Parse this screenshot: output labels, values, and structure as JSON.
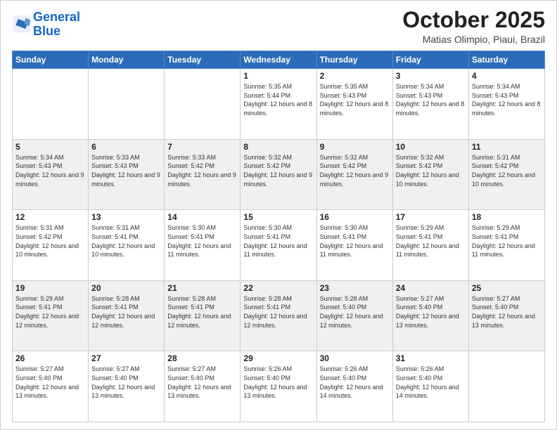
{
  "header": {
    "logo_line1": "General",
    "logo_line2": "Blue",
    "month": "October 2025",
    "location": "Matias Olimpio, Piaui, Brazil"
  },
  "weekdays": [
    "Sunday",
    "Monday",
    "Tuesday",
    "Wednesday",
    "Thursday",
    "Friday",
    "Saturday"
  ],
  "weeks": [
    [
      {
        "day": "",
        "sunrise": "",
        "sunset": "",
        "daylight": ""
      },
      {
        "day": "",
        "sunrise": "",
        "sunset": "",
        "daylight": ""
      },
      {
        "day": "",
        "sunrise": "",
        "sunset": "",
        "daylight": ""
      },
      {
        "day": "1",
        "sunrise": "Sunrise: 5:35 AM",
        "sunset": "Sunset: 5:44 PM",
        "daylight": "Daylight: 12 hours and 8 minutes."
      },
      {
        "day": "2",
        "sunrise": "Sunrise: 5:35 AM",
        "sunset": "Sunset: 5:43 PM",
        "daylight": "Daylight: 12 hours and 8 minutes."
      },
      {
        "day": "3",
        "sunrise": "Sunrise: 5:34 AM",
        "sunset": "Sunset: 5:43 PM",
        "daylight": "Daylight: 12 hours and 8 minutes."
      },
      {
        "day": "4",
        "sunrise": "Sunrise: 5:34 AM",
        "sunset": "Sunset: 5:43 PM",
        "daylight": "Daylight: 12 hours and 8 minutes."
      }
    ],
    [
      {
        "day": "5",
        "sunrise": "Sunrise: 5:34 AM",
        "sunset": "Sunset: 5:43 PM",
        "daylight": "Daylight: 12 hours and 9 minutes."
      },
      {
        "day": "6",
        "sunrise": "Sunrise: 5:33 AM",
        "sunset": "Sunset: 5:43 PM",
        "daylight": "Daylight: 12 hours and 9 minutes."
      },
      {
        "day": "7",
        "sunrise": "Sunrise: 5:33 AM",
        "sunset": "Sunset: 5:42 PM",
        "daylight": "Daylight: 12 hours and 9 minutes."
      },
      {
        "day": "8",
        "sunrise": "Sunrise: 5:32 AM",
        "sunset": "Sunset: 5:42 PM",
        "daylight": "Daylight: 12 hours and 9 minutes."
      },
      {
        "day": "9",
        "sunrise": "Sunrise: 5:32 AM",
        "sunset": "Sunset: 5:42 PM",
        "daylight": "Daylight: 12 hours and 9 minutes."
      },
      {
        "day": "10",
        "sunrise": "Sunrise: 5:32 AM",
        "sunset": "Sunset: 5:42 PM",
        "daylight": "Daylight: 12 hours and 10 minutes."
      },
      {
        "day": "11",
        "sunrise": "Sunrise: 5:31 AM",
        "sunset": "Sunset: 5:42 PM",
        "daylight": "Daylight: 12 hours and 10 minutes."
      }
    ],
    [
      {
        "day": "12",
        "sunrise": "Sunrise: 5:31 AM",
        "sunset": "Sunset: 5:42 PM",
        "daylight": "Daylight: 12 hours and 10 minutes."
      },
      {
        "day": "13",
        "sunrise": "Sunrise: 5:31 AM",
        "sunset": "Sunset: 5:41 PM",
        "daylight": "Daylight: 12 hours and 10 minutes."
      },
      {
        "day": "14",
        "sunrise": "Sunrise: 5:30 AM",
        "sunset": "Sunset: 5:41 PM",
        "daylight": "Daylight: 12 hours and 11 minutes."
      },
      {
        "day": "15",
        "sunrise": "Sunrise: 5:30 AM",
        "sunset": "Sunset: 5:41 PM",
        "daylight": "Daylight: 12 hours and 11 minutes."
      },
      {
        "day": "16",
        "sunrise": "Sunrise: 5:30 AM",
        "sunset": "Sunset: 5:41 PM",
        "daylight": "Daylight: 12 hours and 11 minutes."
      },
      {
        "day": "17",
        "sunrise": "Sunrise: 5:29 AM",
        "sunset": "Sunset: 5:41 PM",
        "daylight": "Daylight: 12 hours and 11 minutes."
      },
      {
        "day": "18",
        "sunrise": "Sunrise: 5:29 AM",
        "sunset": "Sunset: 5:41 PM",
        "daylight": "Daylight: 12 hours and 11 minutes."
      }
    ],
    [
      {
        "day": "19",
        "sunrise": "Sunrise: 5:29 AM",
        "sunset": "Sunset: 5:41 PM",
        "daylight": "Daylight: 12 hours and 12 minutes."
      },
      {
        "day": "20",
        "sunrise": "Sunrise: 5:28 AM",
        "sunset": "Sunset: 5:41 PM",
        "daylight": "Daylight: 12 hours and 12 minutes."
      },
      {
        "day": "21",
        "sunrise": "Sunrise: 5:28 AM",
        "sunset": "Sunset: 5:41 PM",
        "daylight": "Daylight: 12 hours and 12 minutes."
      },
      {
        "day": "22",
        "sunrise": "Sunrise: 5:28 AM",
        "sunset": "Sunset: 5:41 PM",
        "daylight": "Daylight: 12 hours and 12 minutes."
      },
      {
        "day": "23",
        "sunrise": "Sunrise: 5:28 AM",
        "sunset": "Sunset: 5:40 PM",
        "daylight": "Daylight: 12 hours and 12 minutes."
      },
      {
        "day": "24",
        "sunrise": "Sunrise: 5:27 AM",
        "sunset": "Sunset: 5:40 PM",
        "daylight": "Daylight: 12 hours and 13 minutes."
      },
      {
        "day": "25",
        "sunrise": "Sunrise: 5:27 AM",
        "sunset": "Sunset: 5:40 PM",
        "daylight": "Daylight: 12 hours and 13 minutes."
      }
    ],
    [
      {
        "day": "26",
        "sunrise": "Sunrise: 5:27 AM",
        "sunset": "Sunset: 5:40 PM",
        "daylight": "Daylight: 12 hours and 13 minutes."
      },
      {
        "day": "27",
        "sunrise": "Sunrise: 5:27 AM",
        "sunset": "Sunset: 5:40 PM",
        "daylight": "Daylight: 12 hours and 13 minutes."
      },
      {
        "day": "28",
        "sunrise": "Sunrise: 5:27 AM",
        "sunset": "Sunset: 5:40 PM",
        "daylight": "Daylight: 12 hours and 13 minutes."
      },
      {
        "day": "29",
        "sunrise": "Sunrise: 5:26 AM",
        "sunset": "Sunset: 5:40 PM",
        "daylight": "Daylight: 12 hours and 13 minutes."
      },
      {
        "day": "30",
        "sunrise": "Sunrise: 5:26 AM",
        "sunset": "Sunset: 5:40 PM",
        "daylight": "Daylight: 12 hours and 14 minutes."
      },
      {
        "day": "31",
        "sunrise": "Sunrise: 5:26 AM",
        "sunset": "Sunset: 5:40 PM",
        "daylight": "Daylight: 12 hours and 14 minutes."
      },
      {
        "day": "",
        "sunrise": "",
        "sunset": "",
        "daylight": ""
      }
    ]
  ]
}
